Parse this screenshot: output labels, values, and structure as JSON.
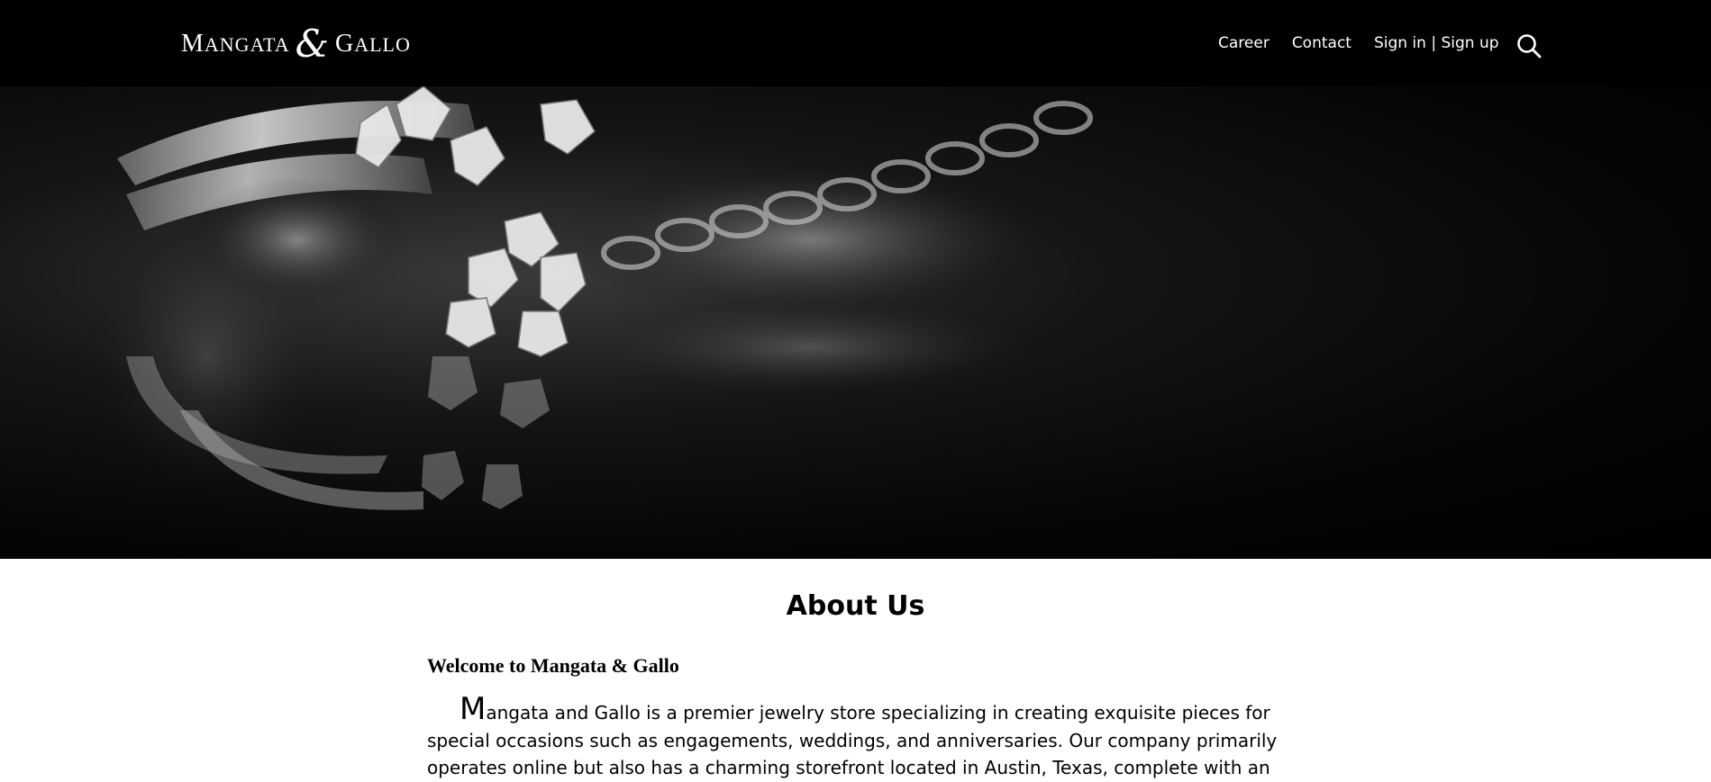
{
  "header": {
    "logo": {
      "part1_cap": "M",
      "part1_rest": "ANGATA",
      "amp": "&",
      "part2_cap": "G",
      "part2_rest": "ALLO"
    },
    "nav": {
      "career": "Career",
      "contact": "Contact",
      "signin": "Sign in | Sign up"
    },
    "search_icon": "search-icon"
  },
  "hero": {
    "image": "silver-ring-and-chain-photo"
  },
  "about": {
    "title": "About Us",
    "welcome": "Welcome to Mangata & Gallo",
    "intro_dropcap": "M",
    "intro_rest": "angata and Gallo is a premier jewelry store specializing in creating exquisite pieces for special occasions such as engagements, weddings, and anniversaries. Our company primarily operates online but also has a charming storefront located in Austin, Texas, complete with an"
  },
  "colors": {
    "header_bg": "#000000",
    "text": "#000000",
    "nav_text": "#ffffff"
  }
}
